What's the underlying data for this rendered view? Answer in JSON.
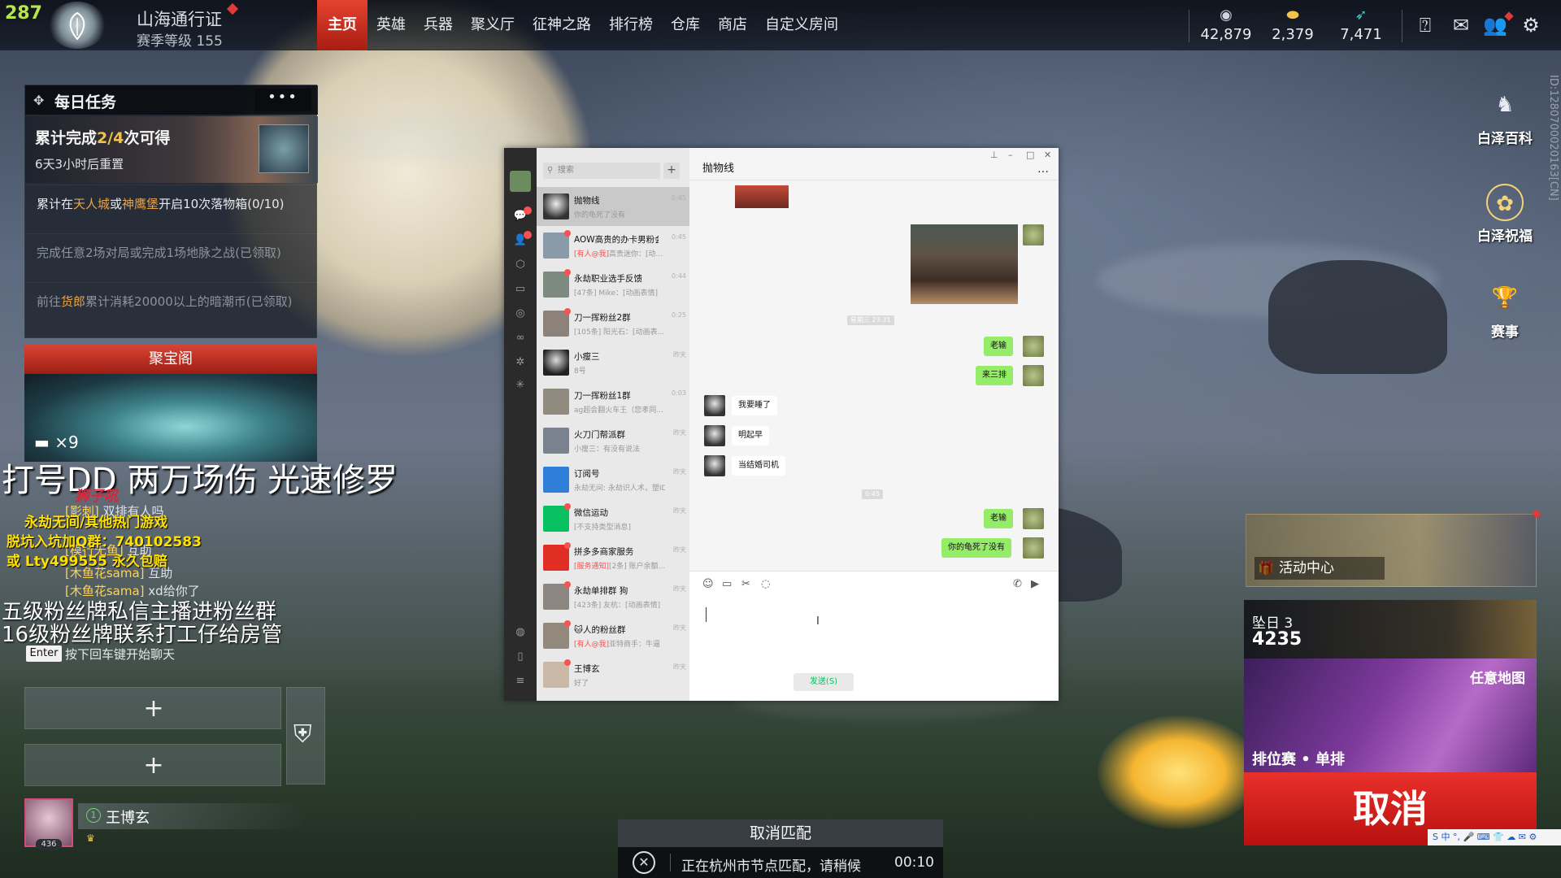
{
  "topbar": {
    "level": "287",
    "pass_title": "山海通行证",
    "season_level": "赛季等级 155",
    "nav": [
      "主页",
      "英雄",
      "兵器",
      "聚义厅",
      "征神之路",
      "排行榜",
      "仓库",
      "商店",
      "自定义房间"
    ],
    "currencies": [
      {
        "icon": "coin-icon",
        "value": "42,879"
      },
      {
        "icon": "gold-ingot-icon",
        "value": "2,379"
      },
      {
        "icon": "feather-icon",
        "value": "7,471"
      }
    ],
    "icons": [
      "help-icon",
      "mail-icon",
      "friends-icon",
      "settings-icon"
    ]
  },
  "daily_tasks": {
    "title": "每日任务",
    "more": "•••",
    "banner_prefix": "累计完成",
    "banner_progress": "2/4",
    "banner_suffix": "次可得",
    "reset": "6天3小时后重置",
    "items": [
      {
        "pre": "累计在",
        "hl1": "天人城",
        "mid": "或",
        "hl2": "神鹰堡",
        "post": "开启10次落物箱(0/10)"
      },
      {
        "text": "完成任意2场对局或完成1场地脉之战(已领取)"
      },
      {
        "pre": "前往",
        "hl1": "货郎",
        "post": "累计消耗20000以上的暗潮币(已领取)"
      }
    ]
  },
  "treasure": {
    "title": "聚宝阁",
    "count": "×9"
  },
  "overlay": {
    "big": "打号DD 两万场伤 光速修罗",
    "red": "狮子吼",
    "yellow_lines": [
      "永劫无间/其他热门游戏",
      "脱坑入坑加Q群：740102583",
      "或     Lty499555  永久包赔"
    ],
    "chat_lines": [
      {
        "name": "[影刺]",
        "text": "双排有人吗"
      },
      {
        "name": "[模行无鱼]",
        "text": "互助"
      },
      {
        "name": "[木鱼花sama]",
        "text": "互助"
      },
      {
        "name": "[木鱼花sama]",
        "text": "xd给你了"
      }
    ],
    "white_lines": [
      "五级粉丝牌私信主播进粉丝群",
      "16级粉丝牌联系打工仔给房管"
    ],
    "enter_key": "Enter",
    "enter_hint": "按下回车键开始聊天"
  },
  "team": {
    "slot_plus": "+",
    "player_name": "王博玄",
    "player_rank": "1",
    "player_level": "436"
  },
  "match": {
    "cancel_label": "取消匹配",
    "status": "正在杭州市节点匹配，请稍候",
    "timer": "00:10"
  },
  "right": {
    "encyclopedia": "白泽百科",
    "blessing": "白泽祝福",
    "events": "赛事",
    "vertical_id": "ID:1280700020163[CN]",
    "activity_center": "活动中心",
    "season_title": "坠日 3",
    "season_score": "4235",
    "map_label": "任意地图",
    "mode_label": "排位赛 • 单排",
    "cancel": "取消",
    "ime": "S 中 °, 🎤 ⌨ 👕 ☁ ✉ ⚙"
  },
  "wechat": {
    "search_placeholder": "搜索",
    "add": "+",
    "chat_title": "抛物线",
    "send": "发送(S)",
    "conversations": [
      {
        "name": "抛物线",
        "msg": "你的龟死了没有",
        "time": "0:45",
        "selected": true
      },
      {
        "name": "AOW高贵的办卡男粉会",
        "msg_red": "[有人@我]",
        "msg": "高贵迷你：[动...",
        "time": "0:45",
        "dot": true
      },
      {
        "name": "永劫职业选手反馈",
        "msg": "[47条] Mike：[动画表情]",
        "time": "0:44",
        "dot": true
      },
      {
        "name": "刀一挥粉丝2群",
        "msg": "[105条] 阳光石：[动画表...",
        "time": "0:25",
        "dot": true
      },
      {
        "name": "小瘦三",
        "msg": "8号",
        "time": "昨天"
      },
      {
        "name": "刀一挥粉丝1群",
        "msg": "ag超会翻火车王（您孝同...",
        "time": "0:03"
      },
      {
        "name": "火刀门帮派群",
        "msg": "小瘦三：有没有说法",
        "time": "昨天"
      },
      {
        "name": "订阅号",
        "msg": "永劫无间: 永劫识人术，塑ID...",
        "time": "昨天"
      },
      {
        "name": "微信运动",
        "msg": "[不支持类型消息]",
        "time": "昨天",
        "dot": true
      },
      {
        "name": "拼多多商家服务",
        "msg_red": "[服务通知]",
        "msg": "[2条] 账户余额...",
        "time": "昨天",
        "dot": true
      },
      {
        "name": "永劫单排群 狗",
        "msg": "[423条] 友杭：[动画表情]",
        "time": "昨天",
        "dot": true
      },
      {
        "name": "🐱人的粉丝群",
        "msg_red": "[有人@我]",
        "msg": "亚特商手：牛逼",
        "time": "昨天",
        "dot": true
      },
      {
        "name": "王博玄",
        "msg": "好了",
        "time": "昨天",
        "dot": true
      }
    ],
    "messages": [
      {
        "from": "me",
        "text": "老输"
      },
      {
        "from": "me",
        "text": "来三排"
      },
      {
        "from": "them",
        "text": "我要睡了"
      },
      {
        "from": "them",
        "text": "明起早"
      },
      {
        "from": "them",
        "text": "当结婚司机"
      },
      {
        "from": "me",
        "text": "老输"
      },
      {
        "from": "me",
        "text": "你的龟死了没有"
      }
    ],
    "timestamps": [
      "星期三 23:31",
      "0:45"
    ]
  }
}
